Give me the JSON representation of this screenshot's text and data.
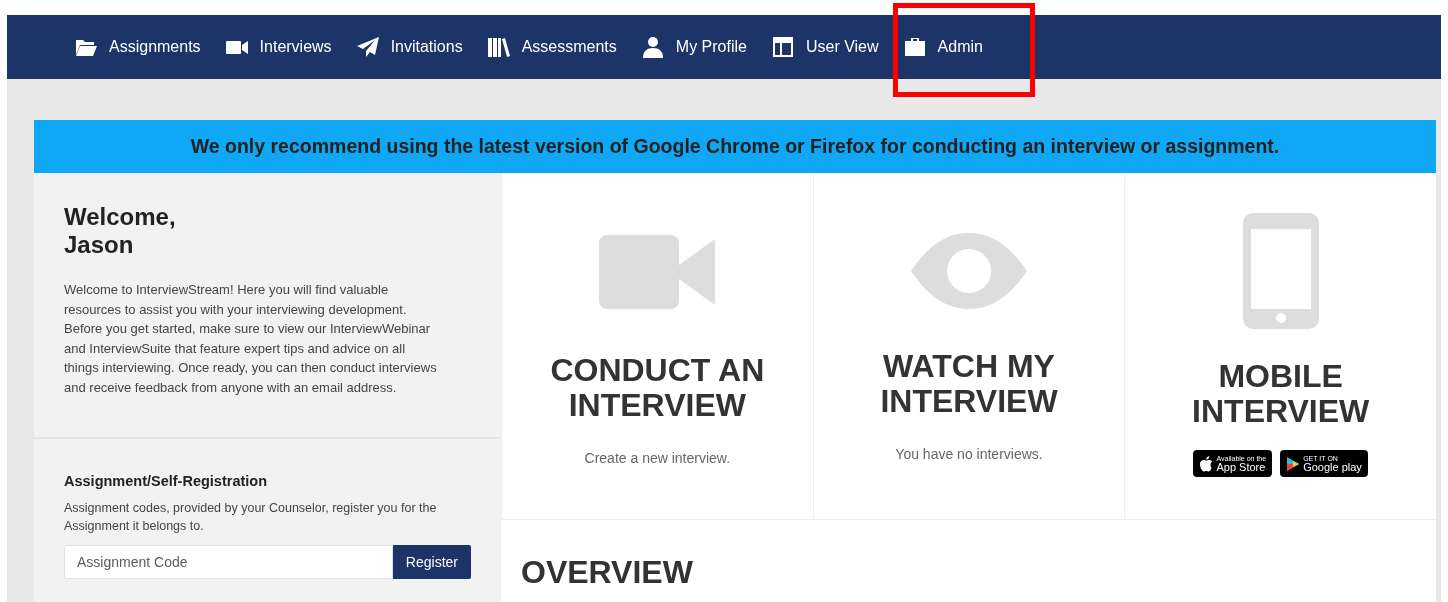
{
  "nav": {
    "items": [
      {
        "label": "Assignments",
        "highlighted": false
      },
      {
        "label": "Interviews",
        "highlighted": false
      },
      {
        "label": "Invitations",
        "highlighted": false
      },
      {
        "label": "Assessments",
        "highlighted": false
      },
      {
        "label": "My Profile",
        "highlighted": false
      },
      {
        "label": "User View",
        "highlighted": false
      },
      {
        "label": "Admin",
        "highlighted": true
      }
    ]
  },
  "banner": "We only recommend using the latest version of Google Chrome or Firefox for conducting an interview or assignment.",
  "welcome": {
    "title_line_1": "Welcome,",
    "title_line_2": "Jason",
    "text": "Welcome to InterviewStream! Here you will find valuable resources to assist you with your interviewing development. Before you get started, make sure to view our InterviewWebinar and InterviewSuite that feature expert tips and advice on all things interviewing. Once ready, you can then conduct interviews and receive feedback from anyone with an email address."
  },
  "registration": {
    "heading": "Assignment/Self-Registration",
    "text": "Assignment codes, provided by your Counselor, register you for the Assignment it belongs to.",
    "placeholder": "Assignment Code",
    "button": "Register"
  },
  "cards": [
    {
      "kind": "conduct",
      "title_line_1": "CONDUCT AN",
      "title_line_2": "INTERVIEW",
      "subtitle": "Create a new interview."
    },
    {
      "kind": "watch",
      "title_line_1": "WATCH MY",
      "title_line_2": "INTERVIEW",
      "subtitle": "You have no interviews."
    },
    {
      "kind": "mobile",
      "title_line_1": "MOBILE",
      "title_line_2": "INTERVIEW",
      "stores": [
        {
          "kind": "apple",
          "small": "Available on the",
          "large": "App Store"
        },
        {
          "kind": "google",
          "small": "GET IT ON",
          "large": "Google play"
        }
      ]
    }
  ],
  "overview": {
    "heading": "OVERVIEW"
  }
}
